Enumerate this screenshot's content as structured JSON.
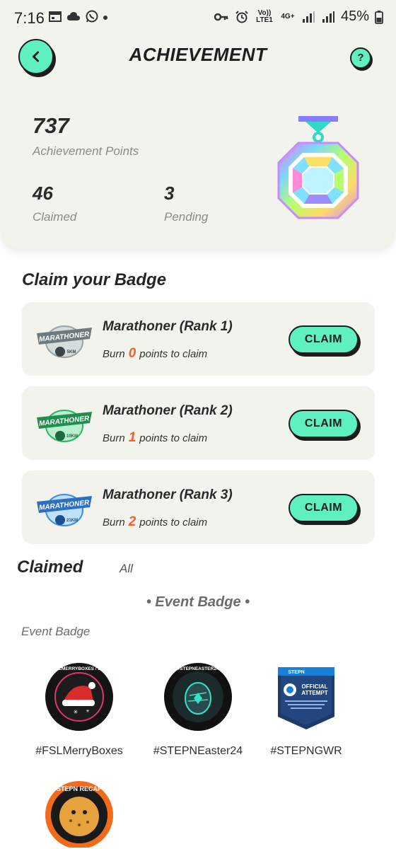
{
  "status_bar": {
    "time": "7:16",
    "battery": "45%",
    "volte": "Vo)) LTE1",
    "network": "4G+"
  },
  "header": {
    "title": "ACHIEVEMENT",
    "help_label": "?"
  },
  "summary": {
    "points_value": "737",
    "points_label": "Achievement Points",
    "claimed_value": "46",
    "claimed_label": "Claimed",
    "pending_value": "3",
    "pending_label": "Pending"
  },
  "claim_section": {
    "title": "Claim your Badge",
    "items": [
      {
        "title": "Marathoner (Rank 1)",
        "burn_prefix": "Burn",
        "burn_value": "0",
        "burn_suffix": "points to claim",
        "button": "CLAIM",
        "badge_text": "MARATHONER",
        "badge_distance": "5KM",
        "badge_color": "#8a9699"
      },
      {
        "title": "Marathoner (Rank 2)",
        "burn_prefix": "Burn",
        "burn_value": "1",
        "burn_suffix": "points to claim",
        "button": "CLAIM",
        "badge_text": "MARATHONER",
        "badge_distance": "10KM",
        "badge_color": "#2fb36a"
      },
      {
        "title": "Marathoner (Rank 3)",
        "burn_prefix": "Burn",
        "burn_value": "2",
        "burn_suffix": "points to claim",
        "button": "CLAIM",
        "badge_text": "MARATHONER",
        "badge_distance": "21KM",
        "badge_color": "#3a8fe0"
      }
    ]
  },
  "claimed_section": {
    "tab_claimed": "Claimed",
    "tab_all": "All",
    "category_header": "• Event Badge •",
    "category_label": "Event Badge",
    "badges": [
      {
        "name": "#FSLMerryBoxes",
        "ring_text": "#FSLMERRYBOXES / 2023"
      },
      {
        "name": "#STEPNEaster24",
        "ring_text": "#STEPNEASTER24"
      },
      {
        "name": "#STEPNGWR",
        "header": "STEPN",
        "title_line1": "OFFICIAL",
        "title_line2": "ATTEMPT"
      }
    ],
    "partial_badge_text": "STEPN RECAP"
  },
  "colors": {
    "accent": "#5ef0c0",
    "panel": "#f3f3ed",
    "highlight_number": "#ff5a2a"
  }
}
